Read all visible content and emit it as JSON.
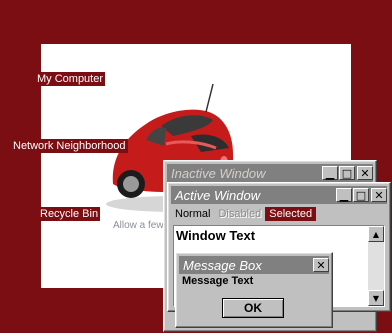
{
  "desktop": {
    "background_color": "#7a0e12",
    "icons": [
      {
        "label": "My Computer"
      },
      {
        "label": "Network Neighborhood"
      },
      {
        "label": "Recycle Bin"
      }
    ],
    "wallpaper": {
      "caption": "Allow a few"
    }
  },
  "inactive_window": {
    "title": "Inactive Window"
  },
  "active_window": {
    "title": "Active Window",
    "menu": {
      "normal": "Normal",
      "disabled": "Disabled",
      "selected": "Selected"
    },
    "window_text": "Window Text"
  },
  "message_box": {
    "title": "Message Box",
    "text": "Message Text",
    "ok_label": "OK"
  },
  "icons": {
    "minimize": "minimize-icon",
    "maximize": "maximize-icon",
    "close": "close-icon",
    "scroll_up": "triangle-up-icon",
    "scroll_down": "triangle-down-icon"
  },
  "colors": {
    "selection": "#7a0e12",
    "titlebar": "#808080",
    "face": "#c0c0c0"
  }
}
